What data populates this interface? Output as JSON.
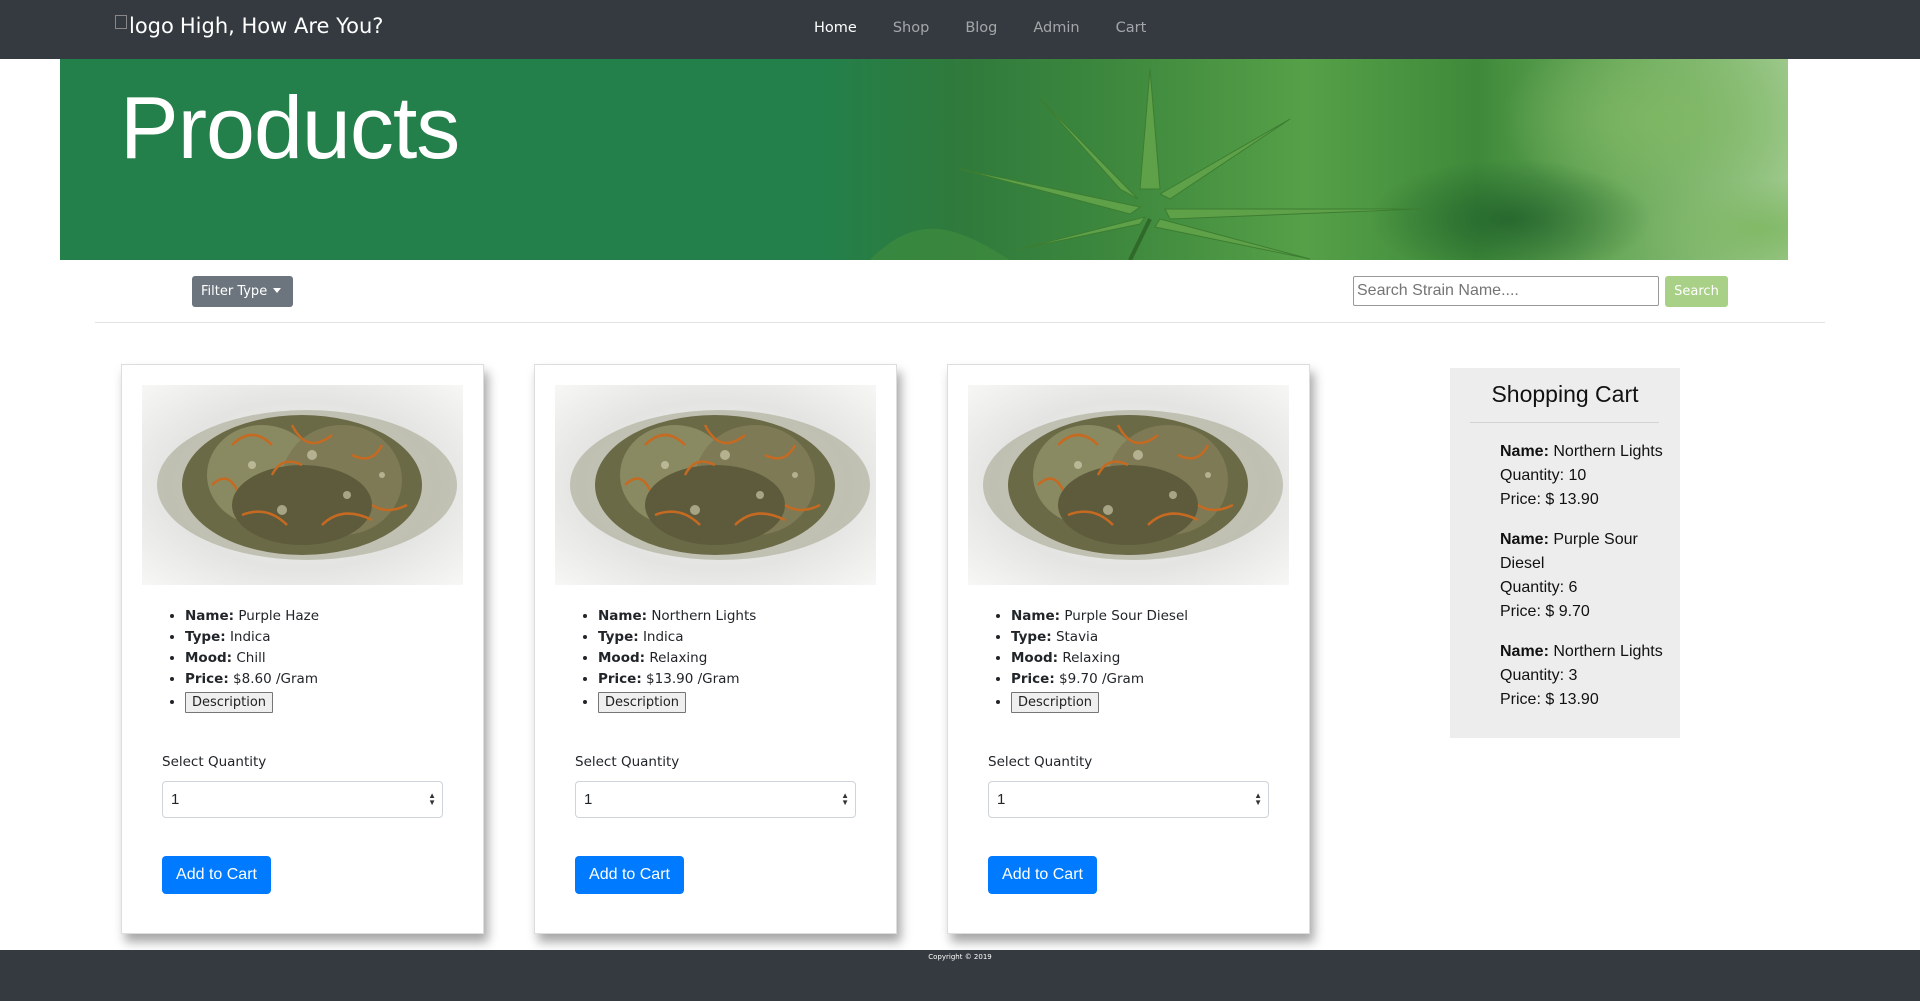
{
  "navbar": {
    "logo_alt": "logo",
    "brand": "High, How Are You?",
    "links": [
      {
        "label": "Home",
        "active": true
      },
      {
        "label": "Shop",
        "active": false
      },
      {
        "label": "Blog",
        "active": false
      },
      {
        "label": "Admin",
        "active": false
      },
      {
        "label": "Cart",
        "active": false
      }
    ]
  },
  "hero": {
    "title": "Products"
  },
  "toolbar": {
    "filter_label": "Filter Type",
    "search_placeholder": "Search Strain Name....",
    "search_label": "Search"
  },
  "products": [
    {
      "name_key": "Name:",
      "name": "Purple Haze",
      "type_key": "Type:",
      "type": "Indica",
      "mood_key": "Mood:",
      "mood": "Chill",
      "price_key": "Price:",
      "price": "$8.60 /Gram",
      "description_label": "Description",
      "qty_label": "Select Quantity",
      "qty_value": "1",
      "add_label": "Add to Cart"
    },
    {
      "name_key": "Name:",
      "name": "Northern Lights",
      "type_key": "Type:",
      "type": "Indica",
      "mood_key": "Mood:",
      "mood": "Relaxing",
      "price_key": "Price:",
      "price": "$13.90 /Gram",
      "description_label": "Description",
      "qty_label": "Select Quantity",
      "qty_value": "1",
      "add_label": "Add to Cart"
    },
    {
      "name_key": "Name:",
      "name": "Purple Sour Diesel",
      "type_key": "Type:",
      "type": "Stavia",
      "mood_key": "Mood:",
      "mood": "Relaxing",
      "price_key": "Price:",
      "price": "$9.70 /Gram",
      "description_label": "Description",
      "qty_label": "Select Quantity",
      "qty_value": "1",
      "add_label": "Add to Cart"
    }
  ],
  "cart": {
    "title": "Shopping Cart",
    "items": [
      {
        "name_key": "Name:",
        "name": "Northern Lights",
        "quantity": "Quantity: 10",
        "price": "Price: $ 13.90"
      },
      {
        "name_key": "Name:",
        "name": "Purple Sour Diesel",
        "quantity": "Quantity: 6",
        "price": "Price: $ 9.70"
      },
      {
        "name_key": "Name:",
        "name": "Northern Lights",
        "quantity": "Quantity: 3",
        "price": "Price: $ 13.90"
      }
    ]
  },
  "footer": {
    "copyright": "Copyright © 2019"
  },
  "colors": {
    "navbar": "#343a40",
    "hero_green": "#23804a",
    "primary": "#007bff",
    "search_button": "#a8d086"
  }
}
